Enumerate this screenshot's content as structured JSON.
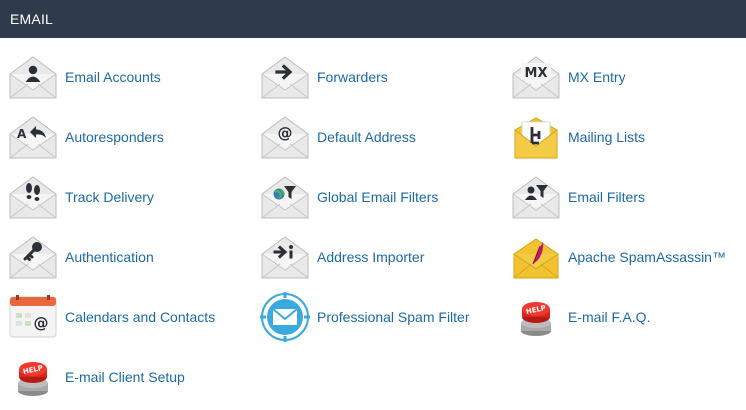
{
  "section": {
    "title": "EMAIL"
  },
  "colors": {
    "header_bg": "#2f3b4c",
    "header_text": "#ffffff",
    "link": "#1b6aa6",
    "envelope": "#e9e9e9",
    "envelope_edge": "#b9b9b9",
    "glyph": "#2a2f38",
    "mailing_yellow": "#f1c232",
    "help_red": "#d9261c"
  },
  "items": [
    {
      "label": "Email Accounts",
      "icon": "email-accounts-icon"
    },
    {
      "label": "Forwarders",
      "icon": "forwarders-icon"
    },
    {
      "label": "MX Entry",
      "icon": "mx-entry-icon"
    },
    {
      "label": "Autoresponders",
      "icon": "autoresponders-icon"
    },
    {
      "label": "Default Address",
      "icon": "default-address-icon"
    },
    {
      "label": "Mailing Lists",
      "icon": "mailing-lists-icon"
    },
    {
      "label": "Track Delivery",
      "icon": "track-delivery-icon"
    },
    {
      "label": "Global Email Filters",
      "icon": "global-email-filters-icon"
    },
    {
      "label": "Email Filters",
      "icon": "email-filters-icon"
    },
    {
      "label": "Authentication",
      "icon": "authentication-icon"
    },
    {
      "label": "Address Importer",
      "icon": "address-importer-icon"
    },
    {
      "label": "Apache SpamAssassin™",
      "icon": "apache-spamassassin-icon"
    },
    {
      "label": "Calendars and Contacts",
      "icon": "calendars-contacts-icon"
    },
    {
      "label": "Professional Spam Filter",
      "icon": "professional-spam-filter-icon"
    },
    {
      "label": "E-mail F.A.Q.",
      "icon": "help-button-icon"
    },
    {
      "label": "E-mail Client Setup",
      "icon": "help-button-icon"
    }
  ],
  "icon_text": {
    "mx": "MX",
    "autoresponder_letter": "A",
    "at": "@",
    "help": "HELP"
  }
}
